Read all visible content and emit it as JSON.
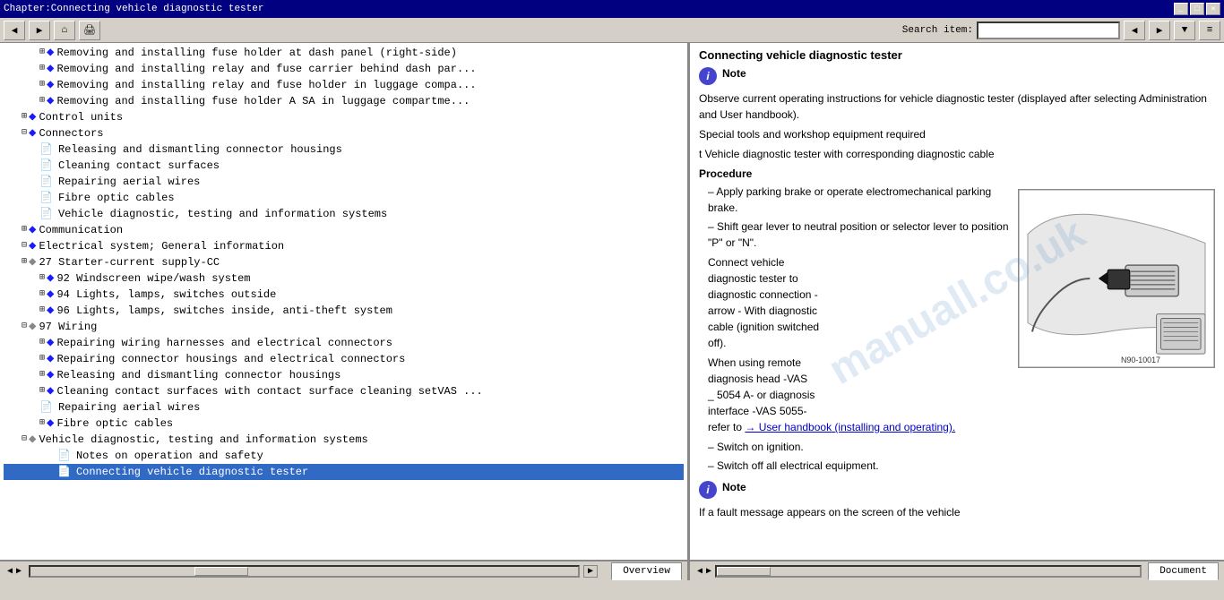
{
  "window": {
    "title": "Chapter:Connecting vehicle diagnostic tester"
  },
  "toolbar": {
    "search_label": "Search item:",
    "search_placeholder": ""
  },
  "toc": {
    "items": [
      {
        "indent": 2,
        "type": "book-expand",
        "text": "Removing and installing fuse holder at dash panel (right-side)"
      },
      {
        "indent": 2,
        "type": "book-expand",
        "text": "Removing and installing relay and fuse carrier behind dash par..."
      },
      {
        "indent": 2,
        "type": "book-expand",
        "text": "Removing and installing relay and fuse holder in luggage compa..."
      },
      {
        "indent": 2,
        "type": "book-expand",
        "text": "Removing and installing fuse holder A SA in luggage compartme..."
      },
      {
        "indent": 1,
        "type": "book-expand",
        "text": "Control units"
      },
      {
        "indent": 1,
        "type": "book-expand",
        "text": "Connectors"
      },
      {
        "indent": 2,
        "type": "doc",
        "text": "Releasing and dismantling connector housings"
      },
      {
        "indent": 2,
        "type": "doc",
        "text": "Cleaning contact surfaces"
      },
      {
        "indent": 2,
        "type": "doc",
        "text": "Repairing aerial wires"
      },
      {
        "indent": 2,
        "type": "doc",
        "text": "Fibre optic cables"
      },
      {
        "indent": 2,
        "type": "doc",
        "text": "Vehicle diagnostic, testing and information systems"
      },
      {
        "indent": 1,
        "type": "book-expand",
        "text": "Communication"
      },
      {
        "indent": 1,
        "type": "book-expand",
        "text": "Electrical system; General information"
      },
      {
        "indent": 1,
        "type": "book-expand-open",
        "text": "27 Starter-current supply-CC"
      },
      {
        "indent": 2,
        "type": "book-expand",
        "text": "92 Windscreen wipe/wash system"
      },
      {
        "indent": 2,
        "type": "book-expand",
        "text": "94 Lights, lamps, switches outside"
      },
      {
        "indent": 2,
        "type": "book-expand",
        "text": "96 Lights, lamps, switches inside, anti-theft system"
      },
      {
        "indent": 1,
        "type": "book-expand-open",
        "text": "97 Wiring"
      },
      {
        "indent": 2,
        "type": "book-expand",
        "text": "Repairing wiring harnesses and electrical connectors"
      },
      {
        "indent": 2,
        "type": "book-expand",
        "text": "Repairing connector housings and electrical connectors"
      },
      {
        "indent": 2,
        "type": "book-expand",
        "text": "Releasing and dismantling connector housings"
      },
      {
        "indent": 2,
        "type": "book-expand",
        "text": "Cleaning contact surfaces with contact surface cleaning setVAS ..."
      },
      {
        "indent": 2,
        "type": "doc",
        "text": "Repairing aerial wires"
      },
      {
        "indent": 2,
        "type": "book-expand",
        "text": "Fibre optic cables"
      },
      {
        "indent": 1,
        "type": "book-expand-open",
        "text": "Vehicle diagnostic, testing and information systems"
      },
      {
        "indent": 3,
        "type": "doc",
        "text": "Notes on operation and safety"
      },
      {
        "indent": 3,
        "type": "doc",
        "text": "Connecting vehicle diagnostic tester"
      }
    ]
  },
  "content": {
    "title": "Connecting vehicle diagnostic tester",
    "note1_label": "Note",
    "note1_text": "Observe current operating instructions for vehicle diagnostic tester (displayed after selecting Administration and User handbook).",
    "special_tools_label": "Special tools and workshop equipment required",
    "tool_item": "t  Vehicle diagnostic tester with corresponding diagnostic cable",
    "procedure_label": "Procedure",
    "steps": [
      "Apply parking brake or operate electromechanical parking brake.",
      "Shift gear lever to neutral position or selector lever to position \"P\" or \"N\".",
      "Connect vehicle diagnostic tester to diagnostic connection - arrow- with diagnostic cable (ignition switched off).",
      "When using remote diagnosis head -VAS _ 5054 A- or diagnosis interface -VAS 5055- refer to",
      "Switch on ignition.",
      "Switch off all electrical equipment."
    ],
    "link_text": "→ User handbook (installing and operating).",
    "note2_label": "Note",
    "note2_text": "If a fault message appears on the screen of the vehicle",
    "diagram_label": "N90-10017",
    "arrow_diagnostic": "arrow - With diagnostic",
    "watermark": "manuall.co.uk"
  },
  "bottom": {
    "tabs_left": [
      {
        "label": "Overview",
        "active": false
      }
    ],
    "tabs_right": [
      {
        "label": "Document",
        "active": false
      }
    ]
  }
}
